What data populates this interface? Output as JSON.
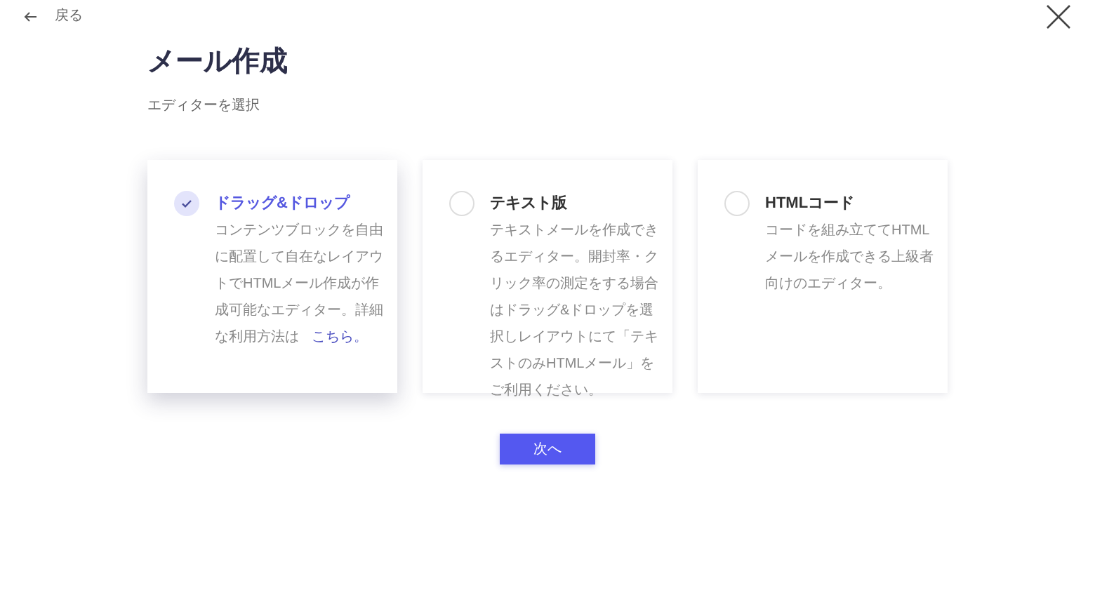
{
  "back": {
    "label": "戻る"
  },
  "title": "メール作成",
  "subtitle": "エディターを選択",
  "options": [
    {
      "title": "ドラッグ&ドロップ",
      "description": "コンテンツブロックを自由に配置して自在なレイアウトでHTMLメール作成が作成可能なエディター。詳細な利用方法は",
      "link": "こちら。",
      "selected": true
    },
    {
      "title": "テキスト版",
      "description": "テキストメールを作成できるエディター。開封率・クリック率の測定をする場合はドラッグ&ドロップを選択しレイアウトにて「テキストのみHTMLメール」をご利用ください。",
      "selected": false
    },
    {
      "title": "HTMLコード",
      "description": "コードを組み立ててHTMLメールを作成できる上級者向けのエディター。",
      "selected": false
    }
  ],
  "next_button": "次へ"
}
